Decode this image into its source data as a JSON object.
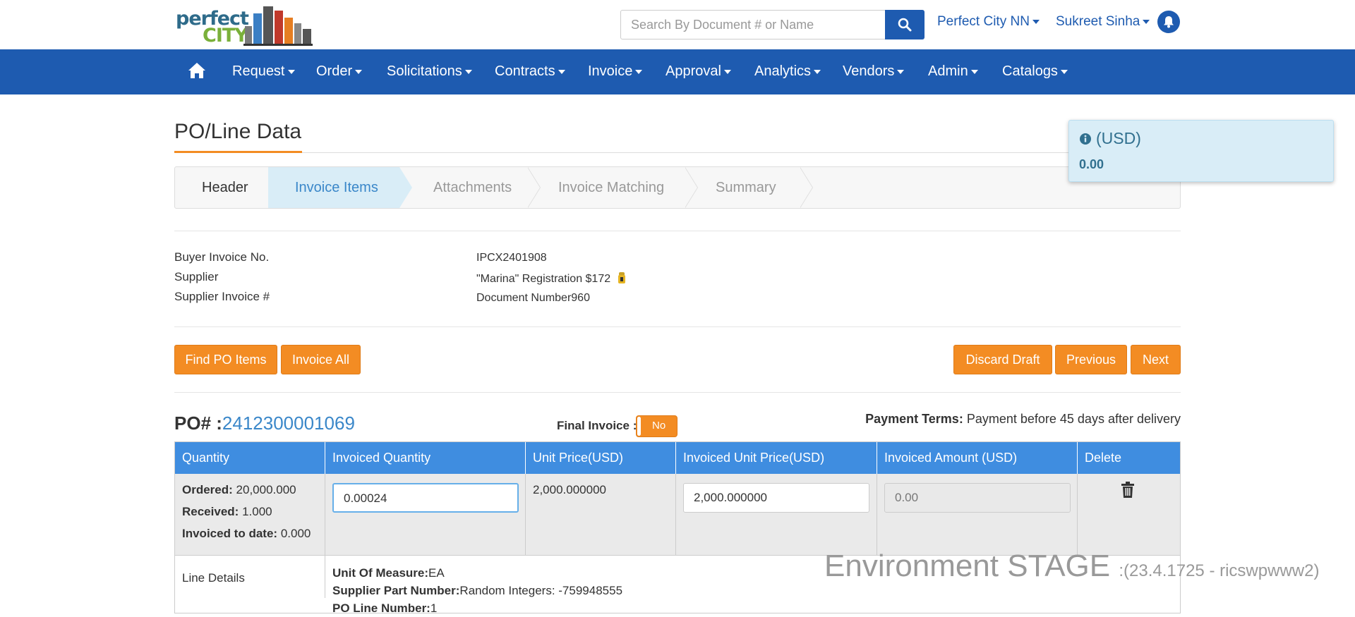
{
  "brand": {
    "line1": "perfect",
    "line2": "CITY"
  },
  "search": {
    "placeholder": "Search By Document # or Name"
  },
  "top": {
    "org": "Perfect City NN",
    "user": "Sukreet Sinha"
  },
  "nav": [
    "Request",
    "Order",
    "Solicitations",
    "Contracts",
    "Invoice",
    "Approval",
    "Analytics",
    "Vendors",
    "Admin",
    "Catalogs"
  ],
  "page": {
    "title": "PO/Line Data"
  },
  "wizard": [
    "Header",
    "Invoice Items",
    "Attachments",
    "Invoice Matching",
    "Summary"
  ],
  "tooltip": {
    "currency": "(USD)",
    "amount": "0.00"
  },
  "info": {
    "buyer_invoice_label": "Buyer Invoice No.",
    "buyer_invoice_value": "IPCX2401908",
    "supplier_label": "Supplier",
    "supplier_value": "\"Marina\" Registration $172",
    "supplier_invoice_label": "Supplier Invoice #",
    "supplier_invoice_value": "Document Number960"
  },
  "buttons": {
    "find_po": "Find PO Items",
    "invoice_all": "Invoice All",
    "discard": "Discard Draft",
    "previous": "Previous",
    "next": "Next"
  },
  "po": {
    "label": "PO# :",
    "number": "2412300001069",
    "final_invoice_label": "Final Invoice :",
    "final_invoice_value": "No",
    "payment_terms_label": "Payment Terms:",
    "payment_terms_value": "Payment before 45 days after delivery"
  },
  "table": {
    "headers": [
      "Quantity",
      "Invoiced Quantity",
      "Unit Price(USD)",
      "Invoiced Unit Price(USD)",
      "Invoiced Amount (USD)",
      "Delete"
    ],
    "row": {
      "ordered_label": "Ordered:",
      "ordered_value": "20,000.000",
      "received_label": "Received:",
      "received_value": "1.000",
      "invoiced_label": "Invoiced to date:",
      "invoiced_value": "0.000",
      "invoiced_quantity": "0.00024",
      "unit_price": "2,000.000000",
      "invoiced_unit_price": "2,000.000000",
      "invoiced_amount": "0.00"
    },
    "line_details": {
      "label": "Line Details",
      "uom_label": "Unit Of Measure:",
      "uom_value": "EA",
      "spn_label": "Supplier Part Number:",
      "spn_value": "Random Integers: -759948555",
      "pln_label": "PO Line Number:",
      "pln_value": "1"
    }
  },
  "environment": {
    "main": "Environment STAGE",
    "detail": ":(23.4.1725 - ricswpwww2)"
  },
  "colors": {
    "primary": "#1e5bb0",
    "accent": "#f38c23",
    "table_header": "#3f8de0",
    "wizard_active": "#d9edf7"
  }
}
